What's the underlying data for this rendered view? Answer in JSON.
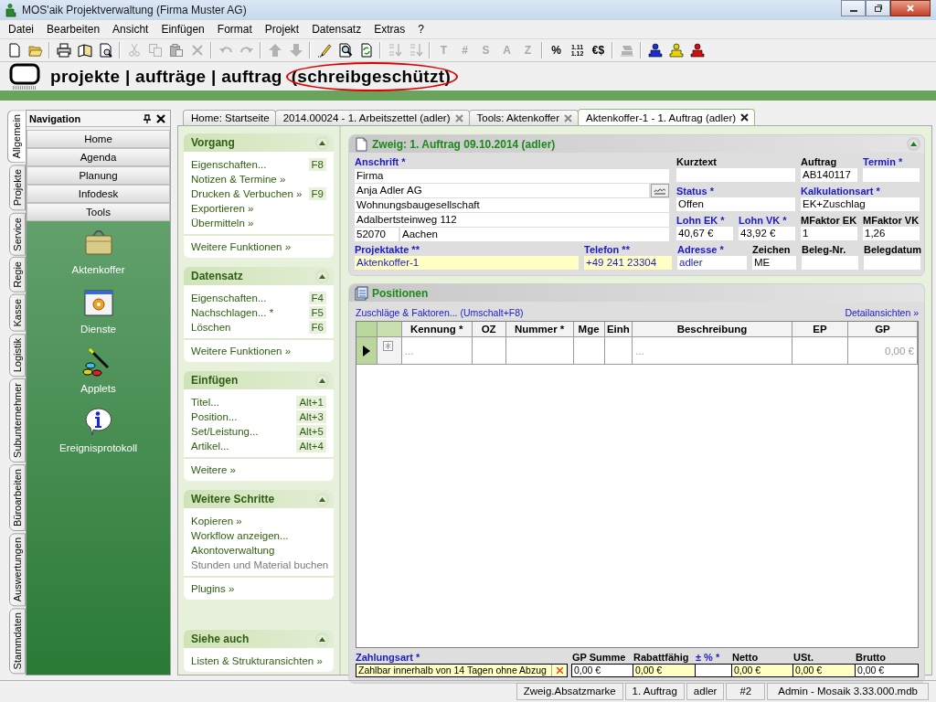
{
  "window": {
    "title": "MOS'aik Projektverwaltung (Firma Muster AG)"
  },
  "menu": [
    "Datei",
    "Bearbeiten",
    "Ansicht",
    "Einfügen",
    "Format",
    "Projekt",
    "Datensatz",
    "Extras",
    "?"
  ],
  "toolbar": [
    {
      "kind": "new",
      "disabled": false
    },
    {
      "kind": "open",
      "disabled": false
    },
    {
      "kind": "separator"
    },
    {
      "kind": "print",
      "disabled": false
    },
    {
      "kind": "book",
      "disabled": false
    },
    {
      "kind": "preview",
      "disabled": false
    },
    {
      "kind": "separator"
    },
    {
      "kind": "cut",
      "disabled": true
    },
    {
      "kind": "copy",
      "disabled": true
    },
    {
      "kind": "paste",
      "disabled": true
    },
    {
      "kind": "delete",
      "disabled": true
    },
    {
      "kind": "separator"
    },
    {
      "kind": "undo",
      "disabled": true
    },
    {
      "kind": "redo",
      "disabled": true
    },
    {
      "kind": "separator"
    },
    {
      "kind": "up",
      "disabled": true
    },
    {
      "kind": "down",
      "disabled": true
    },
    {
      "kind": "separator"
    },
    {
      "kind": "pencil",
      "disabled": false
    },
    {
      "kind": "find",
      "disabled": false
    },
    {
      "kind": "refresh",
      "disabled": false
    },
    {
      "kind": "separator"
    },
    {
      "kind": "sort-asc",
      "disabled": true
    },
    {
      "kind": "sort-desc",
      "disabled": true
    },
    {
      "kind": "separator"
    },
    {
      "kind": "glyph",
      "text": "T",
      "disabled": true
    },
    {
      "kind": "glyph",
      "text": "#",
      "disabled": true
    },
    {
      "kind": "glyph",
      "text": "S",
      "disabled": true
    },
    {
      "kind": "glyph",
      "text": "A",
      "disabled": true
    },
    {
      "kind": "glyph",
      "text": "Z",
      "disabled": true
    },
    {
      "kind": "separator"
    },
    {
      "kind": "glyph",
      "text": "%",
      "disabled": false
    },
    {
      "kind": "glyph2",
      "lines": [
        "1.11",
        "1.12"
      ],
      "disabled": false
    },
    {
      "kind": "glyph",
      "text": "€$",
      "disabled": false
    },
    {
      "kind": "separator"
    },
    {
      "kind": "stamp",
      "disabled": true
    },
    {
      "kind": "separator"
    },
    {
      "kind": "person",
      "color": "#1a2fd0",
      "disabled": false
    },
    {
      "kind": "person",
      "color": "#e8d400",
      "disabled": false
    },
    {
      "kind": "person",
      "color": "#d01010",
      "disabled": false
    }
  ],
  "header": {
    "path": "projekte | aufträge | auftrag",
    "suffix": "(schreibgeschützt)",
    "suffix_circled": true
  },
  "side_tabs": [
    {
      "label": "Allgemein",
      "selected": true
    },
    {
      "label": "Projekte",
      "selected": false
    },
    {
      "label": "Service",
      "selected": false
    },
    {
      "label": "Regie",
      "selected": false
    },
    {
      "label": "Kasse",
      "selected": false
    },
    {
      "label": "Logistik",
      "selected": false
    },
    {
      "label": "Subunternehmer",
      "selected": false
    },
    {
      "label": "Büroarbeiten",
      "selected": false
    },
    {
      "label": "Auswertungen",
      "selected": false
    },
    {
      "label": "Stammdaten",
      "selected": false
    }
  ],
  "navigation": {
    "title": "Navigation",
    "buttons": [
      "Home",
      "Agenda",
      "Planung",
      "Infodesk",
      "Tools"
    ],
    "tools": [
      {
        "label": "Aktenkoffer",
        "kind": "briefcase"
      },
      {
        "label": "Dienste",
        "kind": "services"
      },
      {
        "label": "Applets",
        "kind": "applets"
      },
      {
        "label": "Ereignisprotokoll",
        "kind": "info"
      }
    ]
  },
  "doc_tabs": [
    {
      "label": "Home: Startseite",
      "selected": false,
      "closable": false
    },
    {
      "label": "2014.00024 - 1. Arbeitszettel (adler)",
      "selected": false,
      "closable": true
    },
    {
      "label": "Tools: Aktenkoffer",
      "selected": false,
      "closable": true
    },
    {
      "label": "Aktenkoffer-1 - 1. Auftrag (adler)",
      "selected": true,
      "closable": true
    }
  ],
  "task_pane": [
    {
      "title": "Vorgang",
      "expanded": true,
      "groups": [
        [
          {
            "label": "Eigenschaften...",
            "shortcut": "F8",
            "disabled": false
          },
          {
            "label": "Notizen & Termine »",
            "disabled": false
          },
          {
            "label": "Drucken & Verbuchen »",
            "shortcut": "F9",
            "disabled": false
          },
          {
            "label": "Exportieren »",
            "disabled": false
          },
          {
            "label": "Übermitteln »",
            "disabled": false
          }
        ],
        [
          {
            "label": "Weitere Funktionen »",
            "disabled": false
          }
        ]
      ]
    },
    {
      "title": "Datensatz",
      "expanded": true,
      "groups": [
        [
          {
            "label": "Eigenschaften...",
            "shortcut": "F4",
            "disabled": false
          },
          {
            "label": "Nachschlagen... *",
            "shortcut": "F5",
            "disabled": false
          },
          {
            "label": "Löschen",
            "shortcut": "F6",
            "disabled": false
          }
        ],
        [
          {
            "label": "Weitere Funktionen »",
            "disabled": false
          }
        ]
      ]
    },
    {
      "title": "Einfügen",
      "expanded": true,
      "groups": [
        [
          {
            "label": "Titel...",
            "shortcut": "Alt+1",
            "disabled": false
          },
          {
            "label": "Position...",
            "shortcut": "Alt+3",
            "disabled": false
          },
          {
            "label": "Set/Leistung...",
            "shortcut": "Alt+5",
            "disabled": false
          },
          {
            "label": "Artikel...",
            "shortcut": "Alt+4",
            "disabled": false
          }
        ],
        [
          {
            "label": "Weitere »",
            "disabled": false
          }
        ]
      ]
    },
    {
      "title": "Weitere Schritte",
      "expanded": true,
      "groups": [
        [
          {
            "label": "Kopieren »",
            "disabled": false
          },
          {
            "label": "Workflow anzeigen...",
            "disabled": false
          },
          {
            "label": "Akontoverwaltung",
            "disabled": false
          },
          {
            "label": "Stunden und Material buchen",
            "disabled": true
          }
        ],
        [
          {
            "label": "Plugins »",
            "disabled": false
          }
        ]
      ]
    },
    {
      "title": "Siehe auch",
      "expanded": true,
      "groups": [
        [
          {
            "label": "Listen & Strukturansichten »",
            "disabled": false
          }
        ]
      ]
    }
  ],
  "document": {
    "title": "Zweig: 1. Auftrag 09.10.2014 (adler)",
    "expanded": true,
    "address": {
      "label": "Anschrift *",
      "mandatory": true,
      "lines": [
        {
          "value": "Firma",
          "lookup": false
        },
        {
          "value": "Anja Adler AG",
          "lookup": true
        },
        {
          "value": "Wohnungsbaugesellschaft",
          "lookup": false
        },
        {
          "value": "Adalbertsteinweg 112",
          "lookup": false
        }
      ],
      "zip": "52070",
      "city": "Aachen"
    },
    "fields": [
      {
        "label": "Kurztext",
        "mandatory": false
      },
      {
        "label": "Auftrag",
        "mandatory": false,
        "value": "AB140117"
      },
      {
        "label": "Termin *",
        "mandatory": true
      },
      {
        "label": "Status *",
        "mandatory": true,
        "value": "Offen"
      },
      {
        "label": "Kalkulationsart *",
        "mandatory": true,
        "value": "EK+Zuschlag"
      },
      {
        "label": "Lohn EK *",
        "mandatory": true,
        "value": "40,67 €"
      },
      {
        "label": "Lohn VK *",
        "mandatory": true,
        "value": "43,92 €"
      },
      {
        "label": "MFaktor EK",
        "mandatory": false,
        "value": "1"
      },
      {
        "label": "MFaktor VK",
        "mandatory": false,
        "value": "1,26"
      }
    ],
    "bottom_fields": [
      {
        "label": "Projektakte **",
        "mandatory": true,
        "value": "Aktenkoffer-1",
        "linked": true,
        "highlighted": true
      },
      {
        "label": "Telefon **",
        "mandatory": true,
        "value": "+49 241 23304",
        "linked": true,
        "highlighted": true
      },
      {
        "label": "Adresse *",
        "mandatory": true,
        "value": "adler",
        "linked": true,
        "highlighted": false
      },
      {
        "label": "Zeichen",
        "mandatory": false,
        "value": "ME",
        "linked": false,
        "highlighted": false
      },
      {
        "label": "Beleg-Nr.",
        "mandatory": false,
        "linked": false,
        "highlighted": false
      },
      {
        "label": "Belegdatum",
        "mandatory": false,
        "linked": false,
        "highlighted": false
      }
    ]
  },
  "positions": {
    "title": "Positionen",
    "link": "Zuschläge & Faktoren... (Umschalt+F8)",
    "details_link": "Detailansichten »",
    "table": {
      "columns": [
        "Kennung *",
        "OZ",
        "Nummer *",
        "Mge",
        "Einh",
        "Beschreibung",
        "EP",
        "GP"
      ],
      "rows": [
        {
          "current": true,
          "cells": [
            "...",
            null,
            null,
            null,
            null,
            "...",
            null,
            "0,00 €"
          ]
        }
      ]
    },
    "payment": {
      "label": "Zahlungsart *",
      "mandatory": true,
      "value": "Zahlbar innerhalb von 14 Tagen ohne Abzug",
      "clearable": true
    },
    "sums": [
      {
        "label": "GP Summe",
        "mandatory": false,
        "value": "0,00 €",
        "highlighted": false
      },
      {
        "label": "Rabattfähig",
        "mandatory": false,
        "value": "0,00 €",
        "highlighted": true
      },
      {
        "label": "± % *",
        "mandatory": true,
        "highlighted": false
      },
      {
        "label": "Netto",
        "mandatory": false,
        "value": "0,00 €",
        "highlighted": true
      },
      {
        "label": "USt.",
        "mandatory": false,
        "value": "0,00 €",
        "highlighted": true
      },
      {
        "label": "Brutto",
        "mandatory": false,
        "value": "0,00 €",
        "highlighted": false
      }
    ]
  },
  "status_bar": [
    "Zweig.Absatzmarke",
    "1. Auftrag",
    "adler",
    "#2",
    "Admin - Mosaik 3.33.000.mdb"
  ]
}
